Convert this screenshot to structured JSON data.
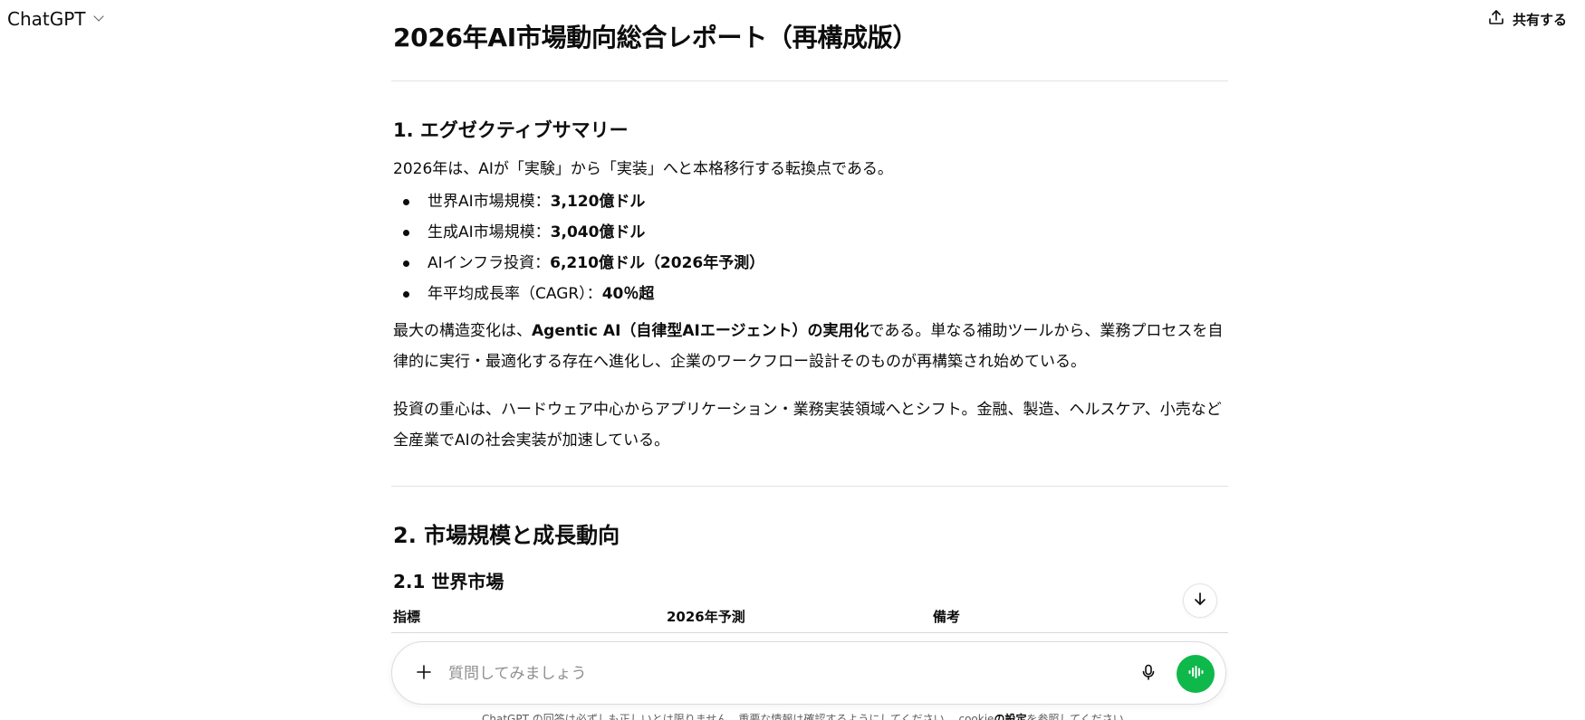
{
  "header": {
    "model_label": "ChatGPT",
    "share_label": "共有する"
  },
  "document": {
    "title": "2026年AI市場動向総合レポート（再構成版）",
    "section1": {
      "heading": "1. エグゼクティブサマリー",
      "intro": "2026年は、AIが「実験」から「実装」へと本格移行する転換点である。",
      "bullets": [
        {
          "label": "世界AI市場規模：",
          "value": "3,120億ドル"
        },
        {
          "label": "生成AI市場規模：",
          "value": "3,040億ドル"
        },
        {
          "label": "AIインフラ投資：",
          "value": "6,210億ドル（2026年予測）"
        },
        {
          "label": "年平均成長率（CAGR）：",
          "value": "40％超"
        }
      ],
      "para1_pre": "最大の構造変化は、",
      "para1_bold": "Agentic AI（自律型AIエージェント）の実用化",
      "para1_post": "である。単なる補助ツールから、業務プロセスを自律的に実行・最適化する存在へ進化し、企業のワークフロー設計そのものが再構築され始めている。",
      "para2": "投資の重心は、ハードウェア中心からアプリケーション・業務実装領域へとシフト。金融、製造、ヘルスケア、小売など全産業でAIの社会実装が加速している。"
    },
    "section2": {
      "heading": "2. 市場規模と成長動向",
      "sub1": {
        "heading": "2.1 世界市場",
        "columns": [
          "指標",
          "2026年予測",
          "備考"
        ]
      }
    }
  },
  "composer": {
    "placeholder": "質問してみましょう",
    "value": ""
  },
  "footer": {
    "disclaimer_pre": "ChatGPT の回答は必ずしも正しいとは限りません。重要な情報は確認するようにしてください。",
    "disclaimer_mid": "cookie",
    "disclaimer_bold": "の設定",
    "disclaimer_post": "を参照してください。"
  },
  "colors": {
    "accent_voice": "#0fb84a",
    "text": "#0d0d0d",
    "muted": "#8f8f8f",
    "divider": "#e2e2e2"
  },
  "icons": {
    "share": "share-icon",
    "chevron": "chevron-down-icon",
    "plus": "plus-icon",
    "mic": "microphone-icon",
    "voice": "voice-mode-icon",
    "scroll": "arrow-down-icon"
  }
}
